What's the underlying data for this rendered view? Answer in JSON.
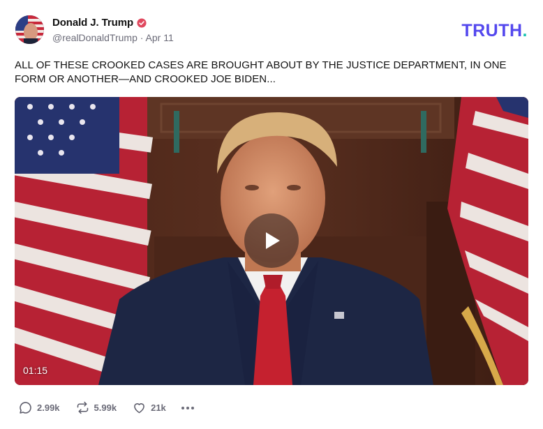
{
  "author": {
    "display_name": "Donald J. Trump",
    "handle": "@realDonaldTrump",
    "separator": "·",
    "date": "Apr 11",
    "verified_icon": "verified-badge-icon"
  },
  "brand": {
    "logo_text": "TRUTH",
    "logo_dot": ".",
    "colors": {
      "primary": "#5448ee",
      "accent": "#18c2b0"
    }
  },
  "post": {
    "text": "ALL OF THESE CROOKED CASES ARE BROUGHT ABOUT BY THE JUSTICE DEPARTMENT, IN ONE FORM OR ANOTHER—AND CROOKED JOE BIDEN..."
  },
  "video": {
    "duration": "01:15",
    "play_icon": "play-icon"
  },
  "actions": {
    "replies": "2.99k",
    "retruths": "5.99k",
    "likes": "21k",
    "reply_icon": "comment-icon",
    "retruth_icon": "repost-icon",
    "like_icon": "heart-icon",
    "more_icon": "more-dots-icon"
  }
}
